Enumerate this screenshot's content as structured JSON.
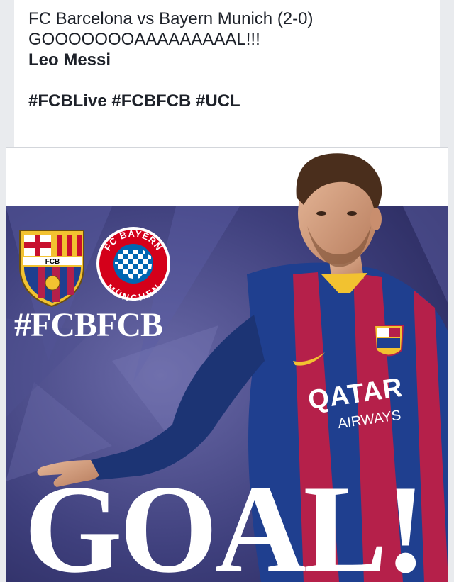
{
  "post": {
    "line1": "FC Barcelona vs Bayern Munich (2-0)",
    "line2": "GOOOOOOOAAAAAAAAAL!!!",
    "line3": "Leo Messi",
    "line5": "#FCBLive #FCBFCB #UCL"
  },
  "graphic": {
    "hashtag": "#FCBFCB",
    "headline": "GOAL!",
    "club1_abbr": "FCB",
    "club2_name_top": "FC BAYERN",
    "club2_name_bottom": "MÜNCHEN",
    "sponsor_line1": "QATAR",
    "sponsor_line2": "AIRWAYS",
    "colors": {
      "background": "#3a3c78",
      "blaugrana_blue": "#1f3f8f",
      "blaugrana_red": "#b5204a",
      "bayern_red": "#d4001a",
      "crest_gold": "#f2c230"
    }
  }
}
